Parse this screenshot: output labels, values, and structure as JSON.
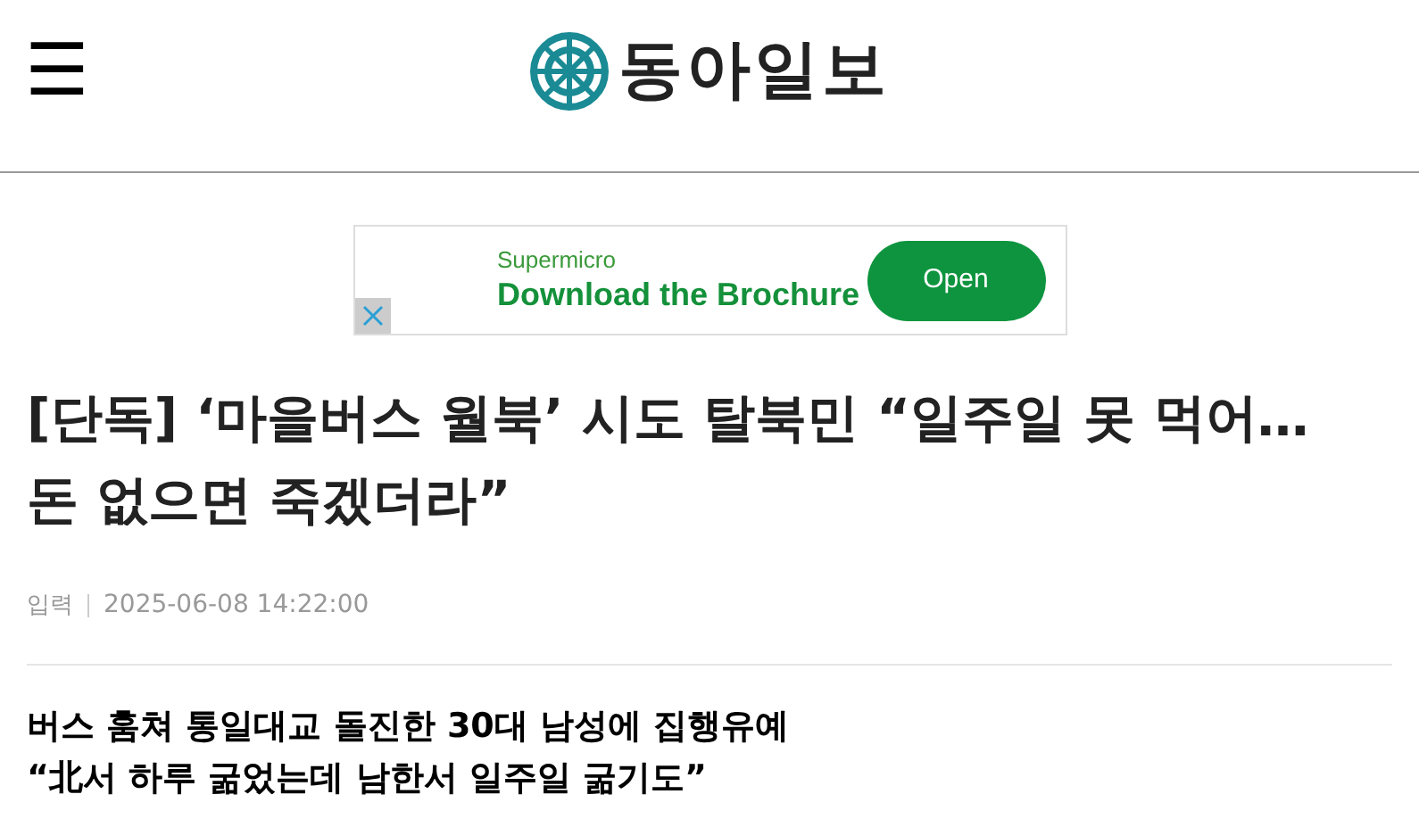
{
  "header": {
    "menu_icon": "☰",
    "logo": "동아일보"
  },
  "ad": {
    "brand": "Supermicro",
    "headline": "Download the Brochure",
    "button": "Open"
  },
  "article": {
    "title": "[단독] ‘마을버스 월북’ 시도 탈북민 “일주일 못 먹어…돈 없으면 죽겠더라”",
    "meta_label": "입력",
    "date": "2025-06-08 14:22:00",
    "subheadings": [
      "버스 훔쳐 통일대교 돌진한 30대 남성에 집행유예",
      "“北서 하루 굶었는데 남한서 일주일 굶기도”"
    ]
  }
}
